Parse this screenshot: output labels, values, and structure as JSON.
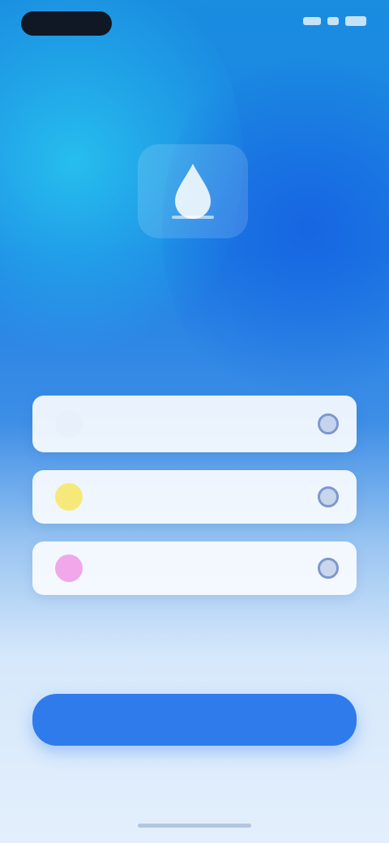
{
  "title": "",
  "subtitle": "",
  "options": [
    {
      "label": "",
      "icon": "spark-icon",
      "color": "#e8f1fb",
      "selected": true
    },
    {
      "label": "",
      "icon": "sun-icon",
      "color": "#f6e979",
      "selected": true
    },
    {
      "label": "",
      "icon": "flower-icon",
      "color": "#f0a8ea",
      "selected": true
    }
  ],
  "primary_button": {
    "label": ""
  },
  "colors": {
    "accent": "#2f7bec",
    "hero_top_left": "#1fc4ea",
    "hero_right": "#1565d8",
    "card": "#f8fbff"
  },
  "icons": {
    "hero": "drop-icon"
  }
}
